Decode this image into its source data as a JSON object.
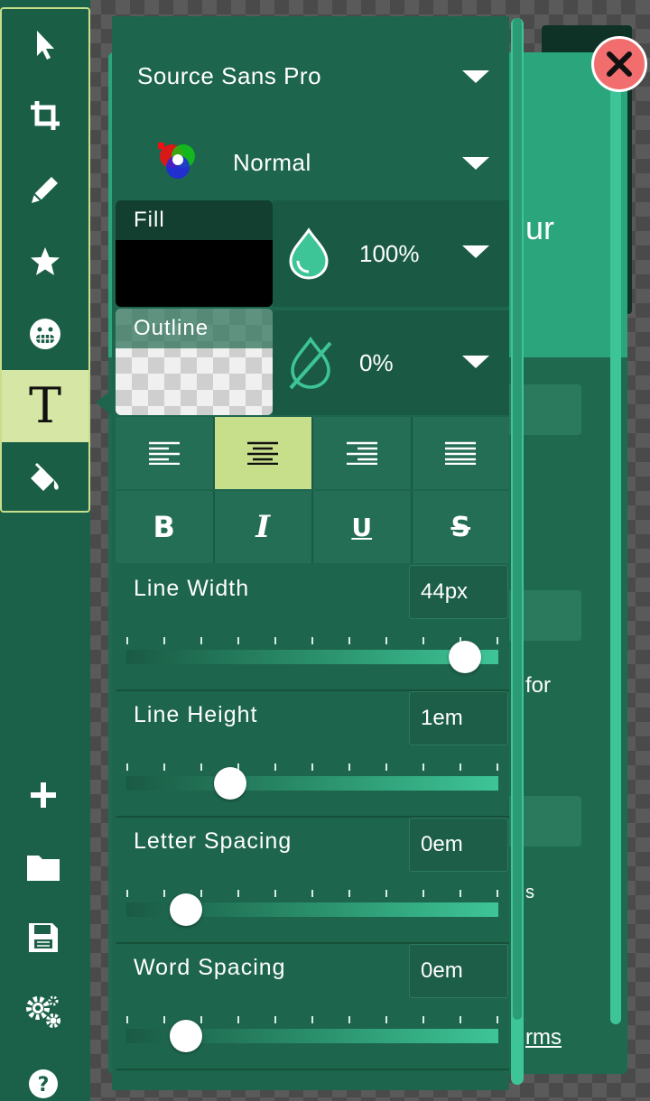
{
  "toolbar": {
    "tools": [
      {
        "name": "pointer-tool",
        "icon": "cursor-arrow-icon",
        "active": false
      },
      {
        "name": "crop-tool",
        "icon": "crop-icon",
        "active": false
      },
      {
        "name": "draw-tool",
        "icon": "pencil-icon",
        "active": false
      },
      {
        "name": "shape-tool",
        "icon": "star-icon",
        "active": false
      },
      {
        "name": "sticker-tool",
        "icon": "grin-emoji-icon",
        "active": false
      },
      {
        "name": "text-tool",
        "icon": "text-T-icon",
        "active": true,
        "label": "T"
      },
      {
        "name": "fill-tool",
        "icon": "paint-bucket-icon",
        "active": false
      }
    ],
    "bottom": [
      "add-icon",
      "folder-icon",
      "save-icon",
      "settings-gears-icon",
      "help-icon"
    ]
  },
  "panel": {
    "font_family": "Source Sans Pro",
    "blend_mode": "Normal",
    "fill": {
      "label": "Fill",
      "color": "#000000",
      "opacity": "100%"
    },
    "outline": {
      "label": "Outline",
      "color": "transparent",
      "opacity": "0%"
    },
    "alignment": {
      "options": [
        "align-left",
        "align-center",
        "align-right",
        "align-justify"
      ],
      "selected": "align-center"
    },
    "format": {
      "bold": "B",
      "italic": "I",
      "underline": "U",
      "strikethrough": "S"
    },
    "line_width": {
      "label": "Line Width",
      "value": "44px",
      "level": 0.91
    },
    "line_height": {
      "label": "Line Height",
      "value": "1em",
      "level": 0.28
    },
    "letter_spacing": {
      "label": "Letter Spacing",
      "value": "0em",
      "level": 0.16
    },
    "word_spacing": {
      "label": "Word Spacing",
      "value": "0em",
      "level": 0.16
    }
  },
  "background_dialog": {
    "fragments": [
      "ur",
      "for",
      "s",
      "rms"
    ]
  },
  "colors": {
    "panel_bg": "#1d654d",
    "accent_green": "#3ec597",
    "active_lime": "#c7de8b",
    "close_red": "#f26e6e"
  }
}
